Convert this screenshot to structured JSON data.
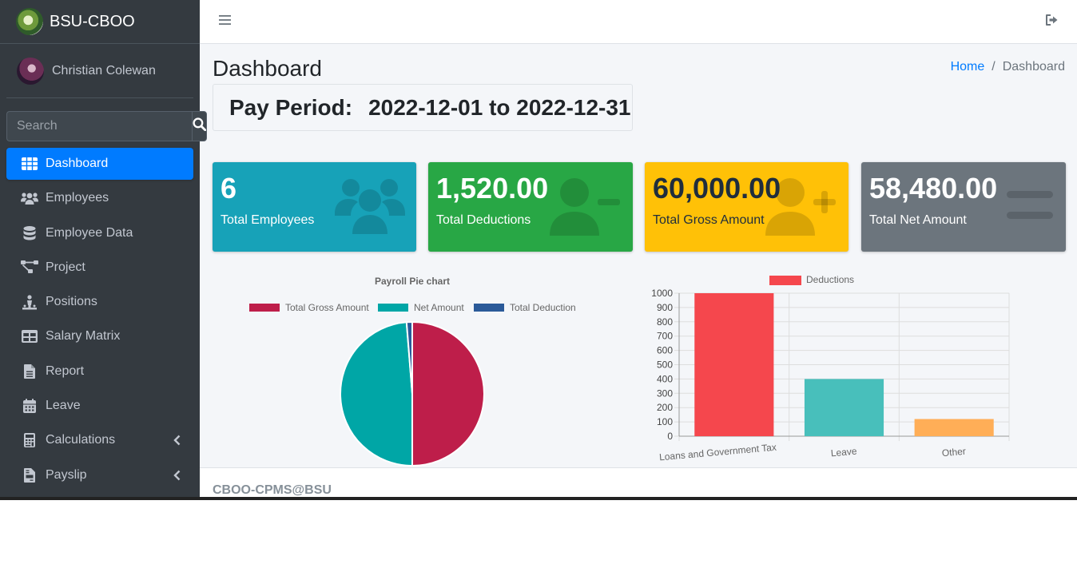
{
  "brand": {
    "title": "BSU-CBOO"
  },
  "user": {
    "name": "Christian Colewan"
  },
  "search": {
    "placeholder": "Search"
  },
  "sidebar": {
    "items": [
      {
        "label": "Dashboard",
        "icon": "th-icon",
        "active": true
      },
      {
        "label": "Employees",
        "icon": "users-icon"
      },
      {
        "label": "Employee Data",
        "icon": "database-icon"
      },
      {
        "label": "Project",
        "icon": "project-diagram-icon"
      },
      {
        "label": "Positions",
        "icon": "person-booth-icon"
      },
      {
        "label": "Salary Matrix",
        "icon": "table-icon"
      },
      {
        "label": "Report",
        "icon": "file-icon"
      },
      {
        "label": "Leave",
        "icon": "calendar-icon"
      },
      {
        "label": "Calculations",
        "icon": "calculator-icon",
        "has_children": true
      },
      {
        "label": "Payslip",
        "icon": "file-invoice-icon",
        "has_children": true
      }
    ]
  },
  "header": {
    "title": "Dashboard"
  },
  "breadcrumb": {
    "home": "Home",
    "separator": "/",
    "current": "Dashboard"
  },
  "pay_period": {
    "label": "Pay Period:",
    "value": "2022-12-01 to 2022-12-31"
  },
  "stats": [
    {
      "value": "6",
      "label": "Total Employees",
      "icon": "users-icon",
      "color": "#17a2b8"
    },
    {
      "value": "1,520.00",
      "label": "Total Deductions",
      "icon": "user-minus-icon",
      "color": "#28a745"
    },
    {
      "value": "60,000.00",
      "label": "Total Gross Amount",
      "icon": "user-plus-icon",
      "color": "#ffc107"
    },
    {
      "value": "58,480.00",
      "label": "Total Net Amount",
      "icon": "equals-icon",
      "color": "#6c757d"
    }
  ],
  "chart_data": [
    {
      "type": "pie",
      "title": "Payroll Pie chart",
      "labels": [
        "Total Gross Amount",
        "Net Amount",
        "Total Deduction"
      ],
      "values": [
        60000,
        58480,
        1520
      ],
      "colors": [
        "#be1e4a",
        "#00a6a6",
        "#2b5a99"
      ],
      "legend": "top"
    },
    {
      "type": "bar",
      "categories": [
        "Loans and Government Tax",
        "Leave",
        "Other"
      ],
      "series": [
        {
          "name": "Deductions",
          "values": [
            1000,
            400,
            120
          ]
        }
      ],
      "colors": [
        "#f5474d",
        "#48bfbb",
        "#ffae57"
      ],
      "yticks": [
        "0",
        "100",
        "200",
        "300",
        "400",
        "500",
        "600",
        "700",
        "800",
        "900",
        "1000"
      ],
      "ylim": [
        0,
        1000
      ],
      "grid": true,
      "legend": "top"
    }
  ],
  "footer": {
    "text": "CBOO-CPMS@BSU"
  }
}
